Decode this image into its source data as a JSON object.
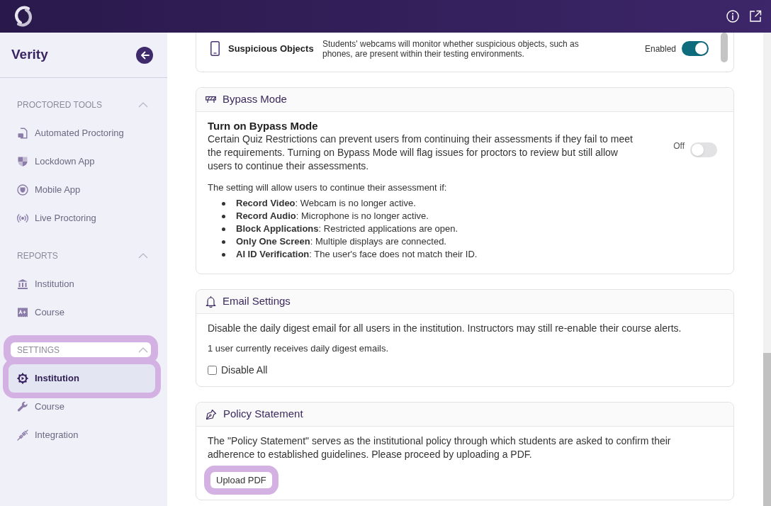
{
  "sidebar": {
    "title": "Verity",
    "sections": [
      {
        "title": "PROCTORED TOOLS",
        "expanded": true,
        "highlighted": false,
        "items": [
          {
            "label": "Automated Proctoring",
            "selected": false,
            "highlighted": false
          },
          {
            "label": "Lockdown App",
            "selected": false,
            "highlighted": false
          },
          {
            "label": "Mobile App",
            "selected": false,
            "highlighted": false
          },
          {
            "label": "Live Proctoring",
            "selected": false,
            "highlighted": false
          }
        ]
      },
      {
        "title": "REPORTS",
        "expanded": true,
        "highlighted": false,
        "items": [
          {
            "label": "Institution",
            "selected": false,
            "highlighted": false
          },
          {
            "label": "Course",
            "selected": false,
            "highlighted": false
          }
        ]
      },
      {
        "title": "SETTINGS",
        "expanded": true,
        "highlighted": true,
        "items": [
          {
            "label": "Institution",
            "selected": true,
            "highlighted": true
          },
          {
            "label": "Course",
            "selected": false,
            "highlighted": false
          },
          {
            "label": "Integration",
            "selected": false,
            "highlighted": false
          }
        ]
      }
    ]
  },
  "suspicious_objects": {
    "title": "Suspicious Objects",
    "description": "Students' webcams will monitor whether suspicious objects, such as phones, are present within their testing environments.",
    "toggle_label": "Enabled",
    "on": true
  },
  "bypass_mode": {
    "title": "Bypass Mode",
    "setting_title": "Turn on Bypass Mode",
    "description": "Certain Quiz Restrictions can prevent users from continuing their assessments if they fail to meet the requirements. Turning on Bypass Mode will flag issues for proctors to review but still allow users to continue their assessments.",
    "toggle_label": "Off",
    "on": false,
    "list_intro": "The setting will allow users to continue their assessment if:",
    "conditions": [
      "**Record Video**: Webcam is no longer active.",
      "**Record Audio**: Microphone is no longer active.",
      "**Block Applications**: Restricted applications are open.",
      "**Only One Screen**: Multiple displays are connected.",
      "**AI ID Verification**: The user's face does not match their ID."
    ]
  },
  "email_settings": {
    "title": "Email Settings",
    "description": "Disable the daily digest email for all users in the institution. Instructors may still re-enable their course alerts.",
    "count_text": "1 user currently receives daily digest emails.",
    "checkbox": {
      "label": "Disable All",
      "checked": false
    }
  },
  "policy_statement": {
    "title": "Policy Statement",
    "description": "The \"Policy Statement\" serves as the institutional policy through which students are asked to confirm their adherence to established guidelines. Please proceed by uploading a PDF.",
    "upload_button": {
      "label": "Upload PDF",
      "highlighted": true
    }
  }
}
